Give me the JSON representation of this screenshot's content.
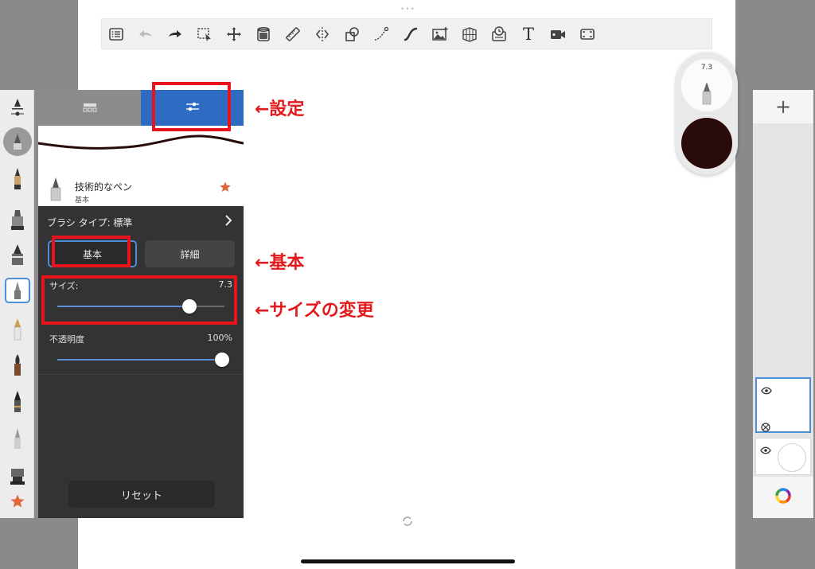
{
  "toolbar": {
    "items": [
      "list-icon",
      "undo-icon",
      "redo-icon",
      "selection-icon",
      "transform-icon",
      "fill-icon",
      "ruler-icon",
      "symmetry-icon",
      "shapes-icon",
      "curve-icon",
      "stroke-icon",
      "image-import-icon",
      "perspective-icon",
      "timelapse-icon",
      "text-icon",
      "video-icon",
      "fullscreen-icon"
    ],
    "text_tool_glyph": "T"
  },
  "brush_rail": {
    "brushes": [
      "ink-pen",
      "airbrush",
      "pencil",
      "marker",
      "felt-pen",
      "technical-pen",
      "fountain-pen",
      "brush-pen",
      "calligraphy-pen",
      "soft-pen",
      "stamp",
      "favorites"
    ]
  },
  "brush_panel": {
    "stroke_color": "#2a0b0b",
    "brush_name": "技術的なペン",
    "brush_category": "基本",
    "brush_type_label": "ブラシ タイプ: 標準",
    "segments": {
      "basic": "基本",
      "detail": "詳細"
    },
    "size": {
      "label": "サイズ:",
      "value_text": "7.3",
      "fraction": 0.79
    },
    "opacity": {
      "label": "不透明度",
      "value_text": "100%",
      "fraction": 1.0
    },
    "reset_label": "リセット"
  },
  "annotations": {
    "settings": "←設定",
    "basic": "←基本",
    "size_change": "←サイズの変更",
    "color": "#e31a1c"
  },
  "puck": {
    "size_value": "7.3",
    "current_color": "#2a0b0b"
  },
  "layers": {
    "add_label": "+"
  }
}
